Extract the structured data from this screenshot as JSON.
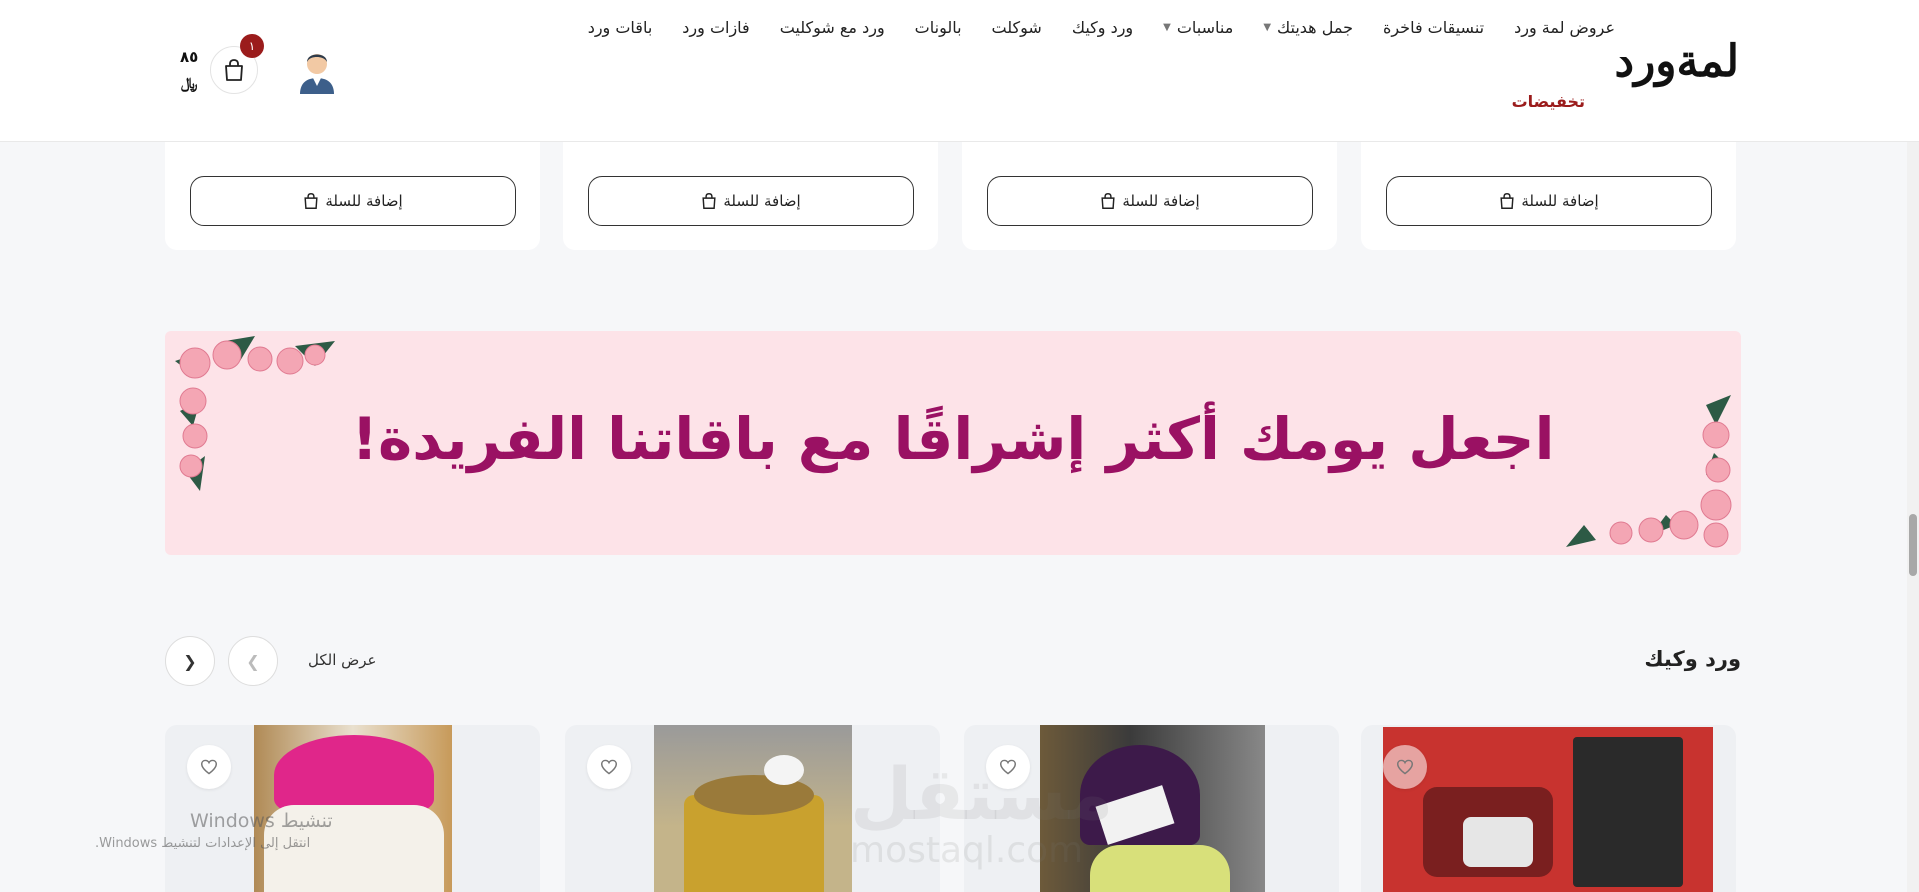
{
  "header": {
    "logo": "لمةورد",
    "nav": [
      {
        "label": "باقات ورد",
        "dropdown": false
      },
      {
        "label": "فازات ورد",
        "dropdown": false
      },
      {
        "label": "ورد مع شوكليت",
        "dropdown": false
      },
      {
        "label": "بالونات",
        "dropdown": false
      },
      {
        "label": "شوكلت",
        "dropdown": false
      },
      {
        "label": "ورد وكيك",
        "dropdown": false
      },
      {
        "label": "مناسبات",
        "dropdown": true
      },
      {
        "label": "جمل هديتك",
        "dropdown": true
      },
      {
        "label": "تنسيقات فاخرة",
        "dropdown": false
      },
      {
        "label": "عروض لمة ورد",
        "dropdown": false
      }
    ],
    "sale_link": "تخفيضات",
    "cart_count": "١",
    "cart_total": "٨٥",
    "currency": "﷼",
    "accent_color": "#9b1c1c"
  },
  "product_row": {
    "add_to_cart_label": "إضافة للسلة"
  },
  "banner": {
    "text": "اجعل يومك أكثر إشراقًا مع باقاتنا الفريدة!",
    "bg_color": "#fde3e8",
    "text_color": "#9a1163"
  },
  "section": {
    "title": "ورد وكيك",
    "view_all": "عرض الكل"
  },
  "overlays": {
    "watermark": "مستقل",
    "watermark_sub": "mostaql.com",
    "windows_title": "تنشيط Windows",
    "windows_sub": "انتقل إلى الإعدادات لتنشيط Windows."
  }
}
